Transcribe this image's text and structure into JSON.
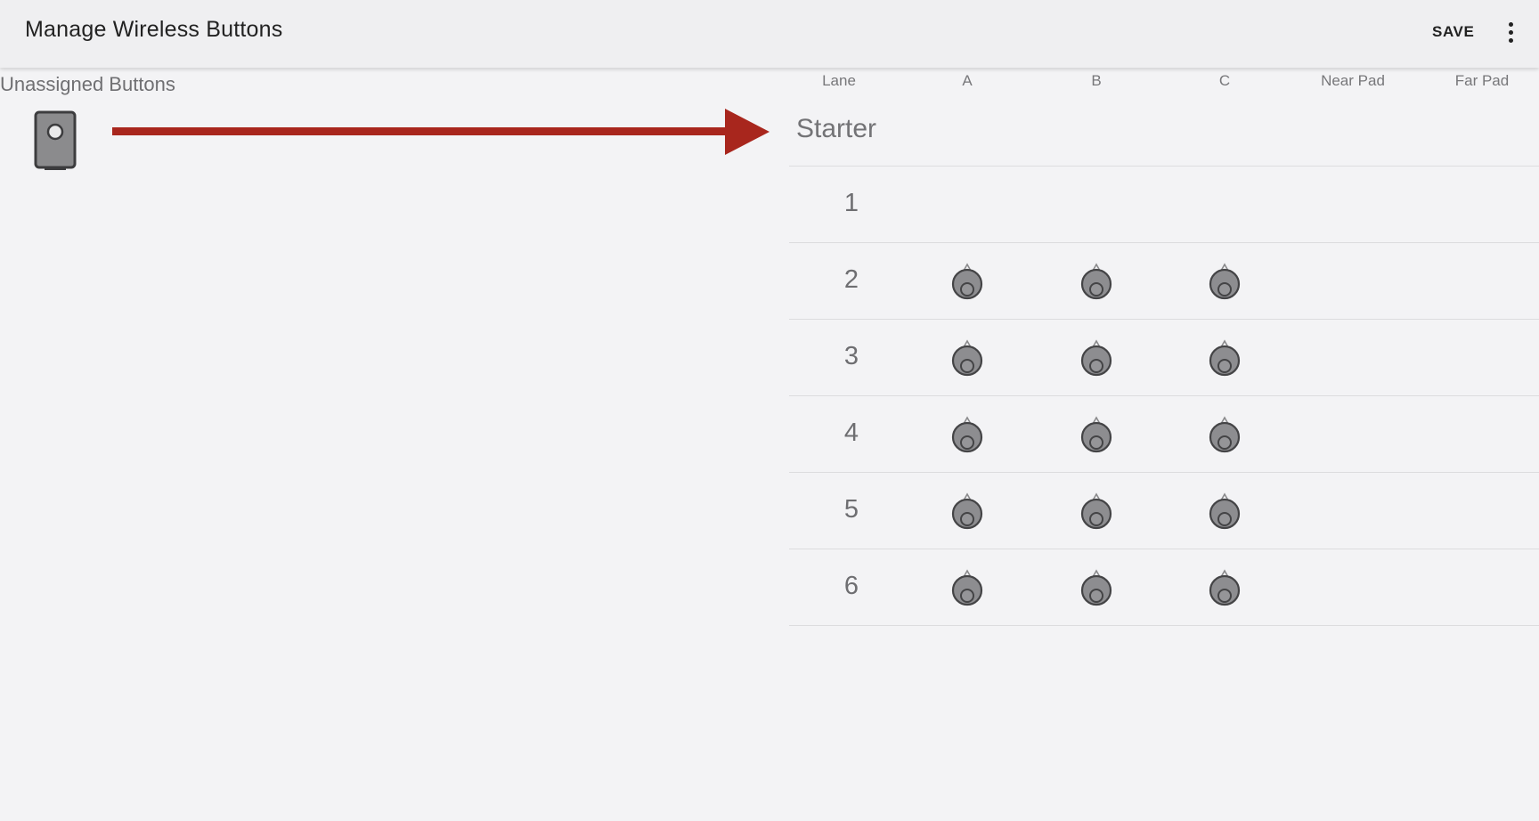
{
  "appbar": {
    "title": "Manage Wireless Buttons",
    "save_label": "SAVE",
    "overflow_icon": "more-vert-icon"
  },
  "unassigned": {
    "heading": "Unassigned Buttons",
    "device_icon": "wireless-button-device-icon"
  },
  "annotation": {
    "arrow_icon": "arrow-right-icon",
    "arrow_color": "#a8261d"
  },
  "table": {
    "columns": [
      "Lane",
      "A",
      "B",
      "C",
      "Near Pad",
      "Far Pad"
    ],
    "starter_label": "Starter",
    "lanes": [
      {
        "lane": "1",
        "assigned": []
      },
      {
        "lane": "2",
        "assigned": [
          "A",
          "B",
          "C"
        ]
      },
      {
        "lane": "3",
        "assigned": [
          "A",
          "B",
          "C"
        ]
      },
      {
        "lane": "4",
        "assigned": [
          "A",
          "B",
          "C"
        ]
      },
      {
        "lane": "5",
        "assigned": [
          "A",
          "B",
          "C"
        ]
      },
      {
        "lane": "6",
        "assigned": [
          "A",
          "B",
          "C"
        ]
      }
    ],
    "slot_icon": "wireless-button-icon"
  }
}
